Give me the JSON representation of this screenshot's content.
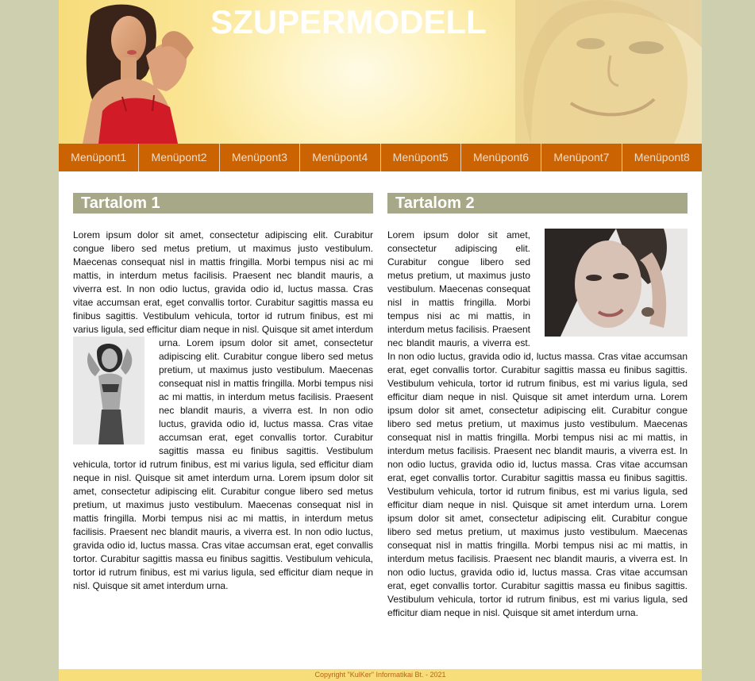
{
  "header": {
    "title": "SZUPERMODELL"
  },
  "menu": {
    "items": [
      {
        "label": "Menüpont1"
      },
      {
        "label": "Menüpont2"
      },
      {
        "label": "Menüpont3"
      },
      {
        "label": "Menüpont4"
      },
      {
        "label": "Menüpont5"
      },
      {
        "label": "Menüpont6"
      },
      {
        "label": "Menüpont7"
      },
      {
        "label": "Menüpont8"
      }
    ]
  },
  "content1": {
    "heading": "Tartalom 1",
    "paragraph_before": "Lorem ipsum dolor sit amet, consectetur adipiscing elit. Curabitur congue libero sed metus pretium, ut maximus justo vestibulum. Maecenas consequat nisl in mattis fringilla. Morbi tempus nisi ac mi mattis, in interdum metus facilisis. Praesent nec blandit mauris, a viverra est. In non odio luctus, gravida odio id, luctus massa. Cras vitae accumsan erat, eget convallis tortor. Curabitur sagittis massa eu finibus sagittis. Vestibulum vehicula, tortor id rutrum finibus, est mi varius ligula, sed efficitur diam neque in nisl. Quisque sit amet interdum urna. Lorem",
    "paragraph_after": "ipsum dolor sit amet, consectetur adipiscing elit. Curabitur congue libero sed metus pretium, ut maximus justo vestibulum. Maecenas consequat nisl in mattis fringilla. Morbi tempus nisi ac mi mattis, in interdum metus facilisis. Praesent nec blandit mauris, a viverra est. In non odio luctus, gravida odio id, luctus massa. Cras vitae accumsan erat, eget convallis tortor. Curabitur sagittis massa eu finibus sagittis. Vestibulum vehicula, tortor id rutrum finibus, est mi varius ligula, sed efficitur diam neque in nisl. Quisque sit amet interdum urna. Lorem ipsum dolor sit amet, consectetur adipiscing elit. Curabitur congue libero sed metus pretium, ut maximus justo vestibulum. Maecenas consequat nisl in mattis fringilla. Morbi tempus nisi ac mi mattis, in interdum metus facilisis. Praesent nec blandit mauris, a viverra est. In non odio luctus, gravida odio id, luctus massa. Cras vitae accumsan erat, eget convallis tortor. Curabitur sagittis massa eu finibus sagittis. Vestibulum vehicula, tortor id rutrum finibus, est mi varius ligula, sed efficitur diam neque in nisl. Quisque sit amet interdum urna."
  },
  "content2": {
    "heading": "Tartalom 2",
    "paragraph": "Lorem ipsum dolor sit amet, consectetur adipiscing elit. Curabitur congue libero sed metus pretium, ut maximus justo vestibulum. Maecenas consequat nisl in mattis fringilla. Morbi tempus nisi ac mi mattis, in interdum metus facilisis. Praesent nec blandit mauris, a viverra est. In non odio luctus, gravida odio id, luctus massa. Cras vitae accumsan erat, eget convallis tortor. Curabitur sagittis massa eu finibus sagittis. Vestibulum vehicula, tortor id rutrum finibus, est mi varius ligula, sed efficitur diam neque in nisl. Quisque sit amet interdum urna. Lorem ipsum dolor sit amet, consectetur adipiscing elit. Curabitur congue libero sed metus pretium, ut maximus justo vestibulum. Maecenas consequat nisl in mattis fringilla. Morbi tempus nisi ac mi mattis, in interdum metus facilisis. Praesent nec blandit mauris, a viverra est. In non odio luctus, gravida odio id, luctus massa. Cras vitae accumsan erat, eget convallis tortor. Curabitur sagittis massa eu finibus sagittis. Vestibulum vehicula, tortor id rutrum finibus, est mi varius ligula, sed efficitur diam neque in nisl. Quisque sit amet interdum urna. Lorem ipsum dolor sit amet, consectetur adipiscing elit. Curabitur congue libero sed metus pretium, ut maximus justo vestibulum. Maecenas consequat nisl in mattis fringilla. Morbi tempus nisi ac mi mattis, in interdum metus facilisis. Praesent nec blandit mauris, a viverra est. In non odio luctus, gravida odio id, luctus massa. Cras vitae accumsan erat, eget convallis tortor. Curabitur sagittis massa eu finibus sagittis. Vestibulum vehicula, tortor id rutrum finibus, est mi varius ligula, sed efficitur diam neque in nisl. Quisque sit amet interdum urna."
  },
  "footer": {
    "text": "Copyright \"KulKer\" Informatikai Bt. - 2021"
  },
  "colors": {
    "page_background": "#cdcfae",
    "menu_background": "#cc6303",
    "heading_background": "#a6a888",
    "footer_background": "#f8de7a"
  }
}
